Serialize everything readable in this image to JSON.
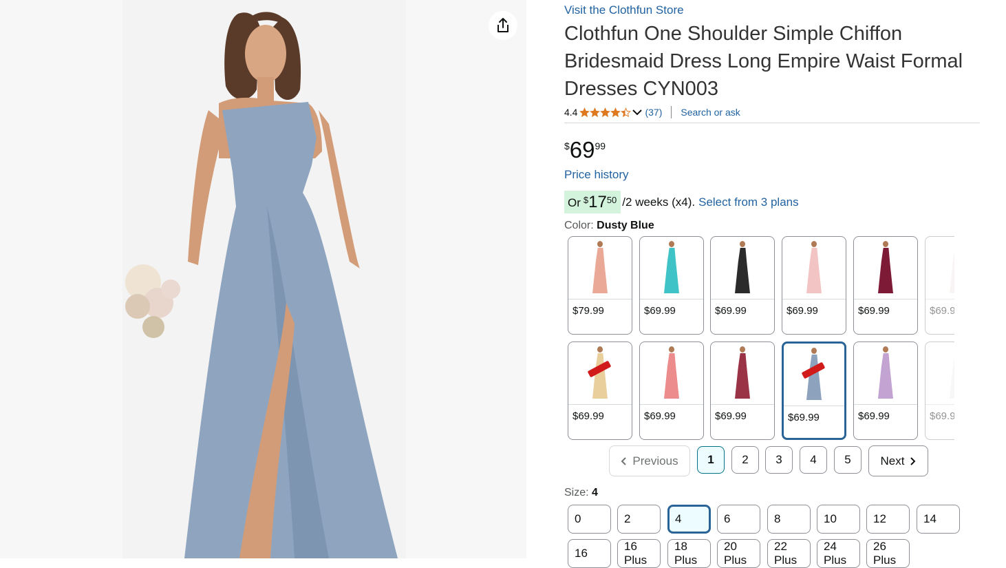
{
  "store_link": "Visit the Clothfun Store",
  "title": "Clothfun One Shoulder Simple Chiffon Bridesmaid Dress Long Empire Waist Formal Dresses CYN003",
  "rating": {
    "value": "4.4",
    "stars": 4.4,
    "count": "(37)",
    "search_or_ask": "Search or ask"
  },
  "price": {
    "symbol": "$",
    "whole": "69",
    "fraction": "99"
  },
  "price_history": "Price history",
  "installment": {
    "or": "Or",
    "symbol": "$",
    "whole": "17",
    "fraction": "50",
    "text": "/2 weeks (x4).",
    "link": "Select from 3 plans"
  },
  "color": {
    "label": "Color:",
    "value": "Dusty Blue"
  },
  "swatches": [
    {
      "price": "$79.99",
      "color": "#e9a996",
      "badge": false,
      "selected": false
    },
    {
      "price": "$69.99",
      "color": "#3fc3c6",
      "badge": false,
      "selected": false
    },
    {
      "price": "$69.99",
      "color": "#2b2b2b",
      "badge": false,
      "selected": false
    },
    {
      "price": "$69.99",
      "color": "#f3c4c4",
      "badge": false,
      "selected": false
    },
    {
      "price": "$69.99",
      "color": "#7d1a35",
      "badge": false,
      "selected": false
    },
    {
      "price": "$69.9",
      "color": "#f6e6e6",
      "badge": false,
      "selected": false
    },
    {
      "price": "$69.99",
      "color": "#e8cf9c",
      "badge": true,
      "selected": false
    },
    {
      "price": "$69.99",
      "color": "#ec8c8c",
      "badge": false,
      "selected": false
    },
    {
      "price": "$69.99",
      "color": "#9b3346",
      "badge": false,
      "selected": false
    },
    {
      "price": "$69.99",
      "color": "#8ca2bd",
      "badge": true,
      "selected": true
    },
    {
      "price": "$69.99",
      "color": "#c2a3d2",
      "badge": false,
      "selected": false
    },
    {
      "price": "$69.9",
      "color": "#efefef",
      "badge": false,
      "selected": false
    }
  ],
  "pagination": {
    "previous": "Previous",
    "next": "Next",
    "pages": [
      "1",
      "2",
      "3",
      "4",
      "5"
    ],
    "current": "1"
  },
  "size": {
    "label": "Size:",
    "value": "4"
  },
  "sizes": [
    "0",
    "2",
    "4",
    "6",
    "8",
    "10",
    "12",
    "14",
    "16",
    "16 Plus",
    "18 Plus",
    "20 Plus",
    "22 Plus",
    "24 Plus",
    "26 Plus"
  ],
  "colors": {
    "link": "#2162a1",
    "star": "#de7921",
    "selected_border": "#2a6496",
    "installment_bg": "#d3f3dd",
    "dress": "#8fa5bf"
  }
}
